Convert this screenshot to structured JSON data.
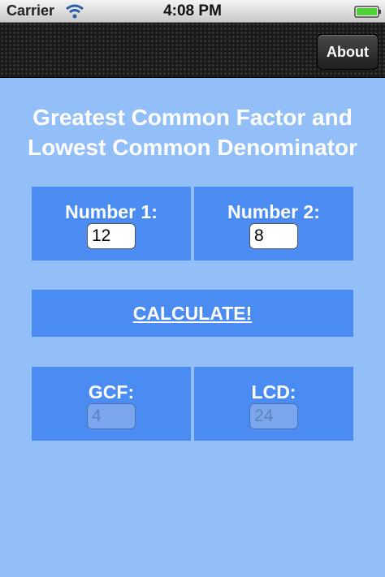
{
  "status_bar": {
    "carrier": "Carrier",
    "time": "4:08 PM"
  },
  "nav_bar": {
    "about_label": "About"
  },
  "title": {
    "line1": "Greatest Common Factor and",
    "line2": "Lowest Common Denominator"
  },
  "inputs": {
    "number1": {
      "label": "Number 1:",
      "value": "12"
    },
    "number2": {
      "label": "Number 2:",
      "value": "8"
    }
  },
  "calculate_label": "CALCULATE!",
  "results": {
    "gcf": {
      "label": "GCF:",
      "value": "4"
    },
    "lcd": {
      "label": "LCD:",
      "value": "24"
    }
  },
  "colors": {
    "background": "#93bff8",
    "panel": "#4b8cf2",
    "nav": "#1a1a1a"
  },
  "icons": [
    "wifi-icon",
    "battery-icon"
  ]
}
